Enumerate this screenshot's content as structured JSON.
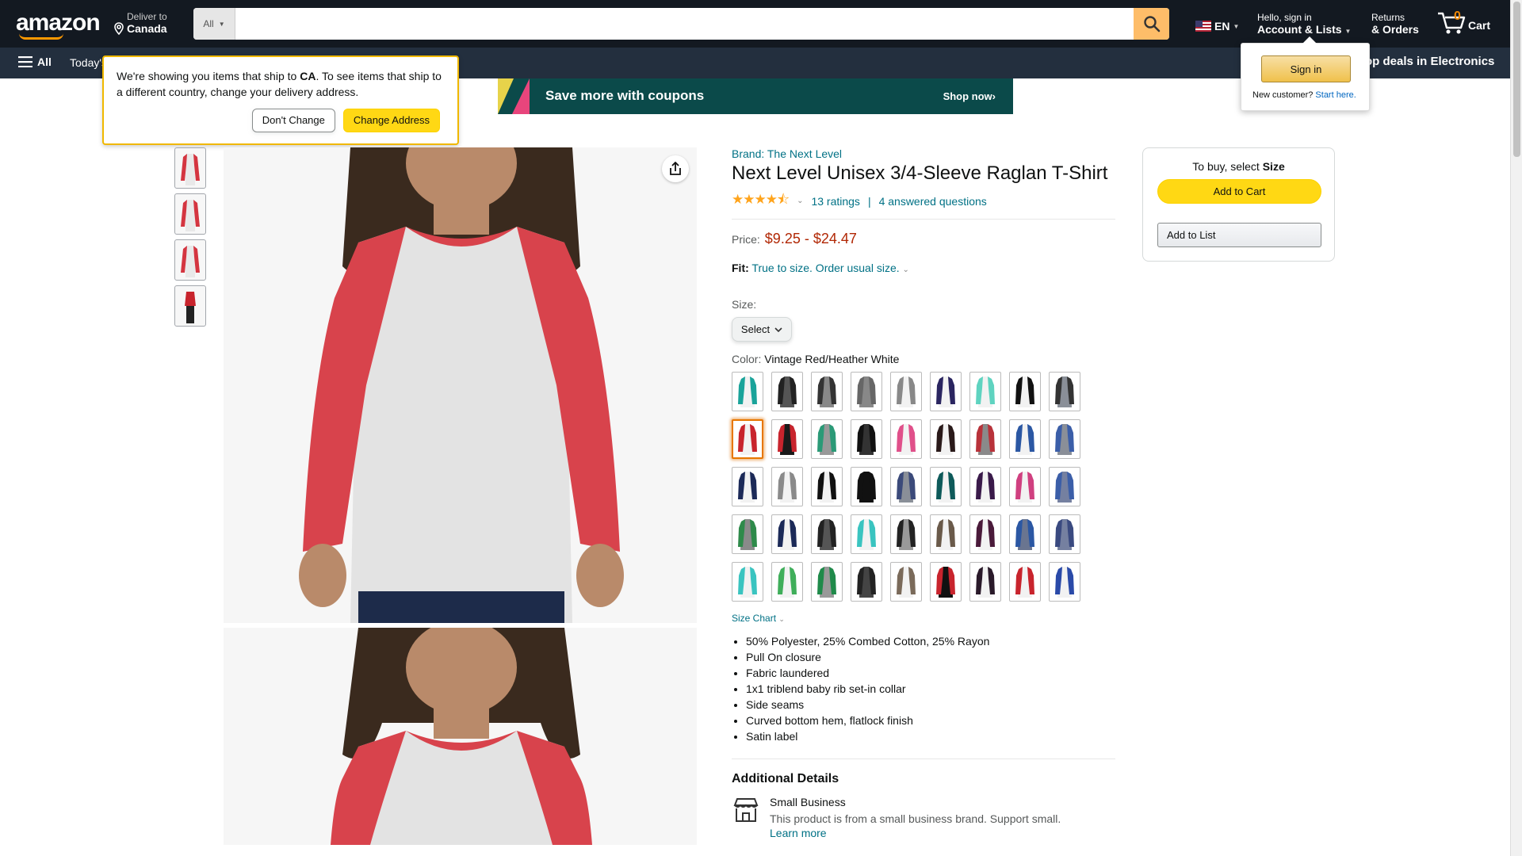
{
  "header": {
    "logo": "amazon",
    "deliver_line1": "Deliver to",
    "deliver_line2": "Canada",
    "search_category": "All",
    "search_placeholder": "",
    "lang": "EN",
    "account_line1": "Hello, sign in",
    "account_line2": "Account & Lists",
    "returns_line1": "Returns",
    "returns_line2": "& Orders",
    "cart_count": "0",
    "cart_label": "Cart"
  },
  "subnav": {
    "all_label": "All",
    "today_label": "Today's",
    "deals_label": "op deals in Electronics"
  },
  "ship_popover": {
    "text_before": "We're showing you items that ship to ",
    "country": "CA",
    "text_after": ". To see items that ship to a different country, change your delivery address.",
    "dont_change": "Don't Change",
    "change_address": "Change Address"
  },
  "signin_popover": {
    "button": "Sign in",
    "new_customer": "New customer?",
    "start_here": "Start here."
  },
  "coupon_banner": {
    "text": "Save more with coupons",
    "cta": "Shop now›"
  },
  "product": {
    "brand": "Brand: The Next Level",
    "title": "Next Level Unisex 3/4-Sleeve Raglan T-Shirt",
    "stars": "★★★★⯪",
    "ratings": "13 ratings",
    "answered": "4 answered questions",
    "price_label": "Price:",
    "price": "$9.25 - $24.47",
    "fit_label": "Fit:",
    "fit_value": "True to size. Order usual size.",
    "size_label": "Size:",
    "size_select": "Select",
    "color_label": "Color:",
    "color_value": "Vintage Red/Heather White",
    "size_chart": "Size Chart",
    "bullets": [
      "50% Polyester, 25% Combed Cotton, 25% Rayon",
      "Pull On closure",
      "Fabric laundered",
      "1x1 triblend baby rib set-in collar",
      "Side seams",
      "Curved bottom hem, flatlock finish",
      "Satin label"
    ],
    "additional_title": "Additional Details",
    "small_business_title": "Small Business",
    "small_business_desc": "This product is from a small business brand. Support small.",
    "learn_more": "Learn more"
  },
  "buybox": {
    "title_prefix": "To buy, select ",
    "title_bold": "Size",
    "add_to_cart": "Add to Cart",
    "add_to_list": "Add to List"
  },
  "swatches": [
    {
      "sleeve": "#1aa39a",
      "body": "#f2f2f2"
    },
    {
      "sleeve": "#222222",
      "body": "#555555"
    },
    {
      "sleeve": "#333333",
      "body": "#888888"
    },
    {
      "sleeve": "#666666",
      "body": "#888888"
    },
    {
      "sleeve": "#888888",
      "body": "#f2f2f2"
    },
    {
      "sleeve": "#2a2560",
      "body": "#f2f2f2"
    },
    {
      "sleeve": "#5fd3c0",
      "body": "#f2f2f2"
    },
    {
      "sleeve": "#111111",
      "body": "#f2f2f2"
    },
    {
      "sleeve": "#333333",
      "body": "#8a8f98"
    },
    {
      "sleeve": "#c8242d",
      "body": "#f2f2f2"
    },
    {
      "sleeve": "#c8242d",
      "body": "#1a1a1a"
    },
    {
      "sleeve": "#2b9a77",
      "body": "#999999"
    },
    {
      "sleeve": "#111111",
      "body": "#333333"
    },
    {
      "sleeve": "#e0508a",
      "body": "#f2f2f2"
    },
    {
      "sleeve": "#2a1a1a",
      "body": "#f2f2f2"
    },
    {
      "sleeve": "#b8323a",
      "body": "#8a8a8a"
    },
    {
      "sleeve": "#2b57a3",
      "body": "#f2f2f2"
    },
    {
      "sleeve": "#3b5ea8",
      "body": "#8a8f98"
    },
    {
      "sleeve": "#1c2a58",
      "body": "#f2f2f2"
    },
    {
      "sleeve": "#8a8a8a",
      "body": "#f2f2f2"
    },
    {
      "sleeve": "#111111",
      "body": "#f2f2f2"
    },
    {
      "sleeve": "#111111",
      "body": "#111111"
    },
    {
      "sleeve": "#3b4a7a",
      "body": "#8a8f98"
    },
    {
      "sleeve": "#0e5a5a",
      "body": "#f2f2f2"
    },
    {
      "sleeve": "#3a1a4a",
      "body": "#f2f2f2"
    },
    {
      "sleeve": "#d04080",
      "body": "#f2f2f2"
    },
    {
      "sleeve": "#3b5ea8",
      "body": "#7580a0"
    },
    {
      "sleeve": "#2e8a4a",
      "body": "#8a8a8a"
    },
    {
      "sleeve": "#1c2a58",
      "body": "#f2f2f2"
    },
    {
      "sleeve": "#222222",
      "body": "#555555"
    },
    {
      "sleeve": "#3ac4c0",
      "body": "#f2f2f2"
    },
    {
      "sleeve": "#222222",
      "body": "#999999"
    },
    {
      "sleeve": "#6a5a4a",
      "body": "#f2f2f2"
    },
    {
      "sleeve": "#4a1a3a",
      "body": "#f2f2f2"
    },
    {
      "sleeve": "#2b57a3",
      "body": "#6a7590"
    },
    {
      "sleeve": "#3a4a80",
      "body": "#7580a0"
    },
    {
      "sleeve": "#3ac4c0",
      "body": "#f2f2f2"
    },
    {
      "sleeve": "#3fae5a",
      "body": "#f2f2f2"
    },
    {
      "sleeve": "#1f8a4a",
      "body": "#999999"
    },
    {
      "sleeve": "#222222",
      "body": "#444444"
    },
    {
      "sleeve": "#7a6a5a",
      "body": "#f2f2f2"
    },
    {
      "sleeve": "#c8242d",
      "body": "#111111"
    },
    {
      "sleeve": "#2a1a2a",
      "body": "#f2f2f2"
    },
    {
      "sleeve": "#c8242d",
      "body": "#f2f2f2"
    },
    {
      "sleeve": "#2a4aa8",
      "body": "#f2f2f2"
    }
  ],
  "selected_swatch": 9,
  "colors": {
    "nav_dark": "#131921",
    "nav_mid": "#232f3e",
    "link": "#007185",
    "price": "#b12704",
    "star": "#ffa41c",
    "button_yellow": "#ffd814"
  }
}
